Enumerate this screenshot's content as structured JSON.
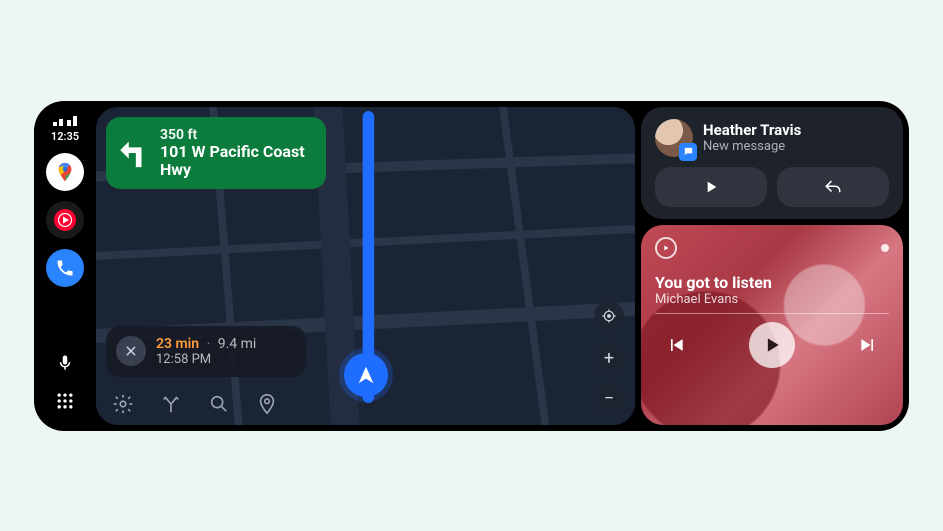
{
  "status": {
    "time": "12:35"
  },
  "sidebar": {
    "apps": [
      "maps",
      "youtube-music",
      "phone"
    ],
    "utilities": [
      "mic",
      "launcher"
    ]
  },
  "navigation": {
    "direction": {
      "distance": "350 ft",
      "road": "101 W Pacific Coast Hwy",
      "maneuver": "turn-left"
    },
    "eta": {
      "duration": "23 min",
      "distance": "9.4 mi",
      "arrival_time": "12:58 PM"
    },
    "tools": [
      "settings",
      "routes",
      "search",
      "destination"
    ]
  },
  "notification": {
    "sender": "Heather Travis",
    "subtitle": "New message",
    "actions": [
      "play",
      "reply"
    ]
  },
  "media": {
    "source": "youtube-music",
    "track_title": "You got to listen",
    "artist": "Michael Evans"
  }
}
